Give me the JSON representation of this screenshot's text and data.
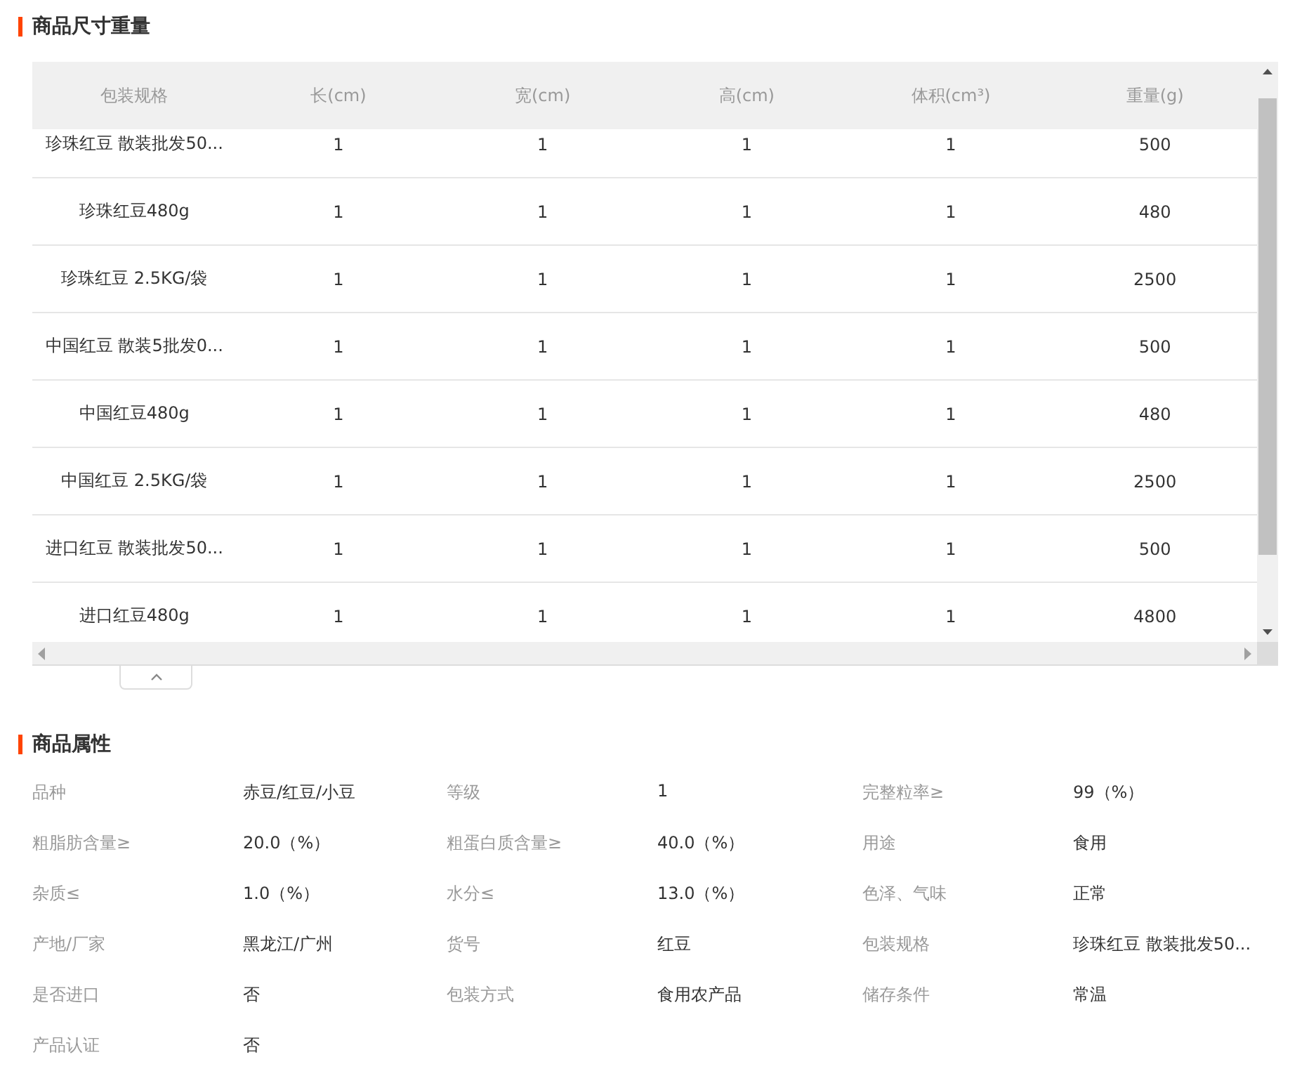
{
  "size_section": {
    "title": "商品尺寸重量",
    "table": {
      "columns": [
        "包装规格",
        "长(cm)",
        "宽(cm)",
        "高(cm)",
        "体积(cm³)",
        "重量(g)"
      ],
      "rows": [
        [
          "珍珠红豆 散装批发50...",
          "1",
          "1",
          "1",
          "1",
          "500"
        ],
        [
          "珍珠红豆480g",
          "1",
          "1",
          "1",
          "1",
          "480"
        ],
        [
          "珍珠红豆 2.5KG/袋",
          "1",
          "1",
          "1",
          "1",
          "2500"
        ],
        [
          "中国红豆 散装5批发0...",
          "1",
          "1",
          "1",
          "1",
          "500"
        ],
        [
          "中国红豆480g",
          "1",
          "1",
          "1",
          "1",
          "480"
        ],
        [
          "中国红豆 2.5KG/袋",
          "1",
          "1",
          "1",
          "1",
          "2500"
        ],
        [
          "进口红豆 散装批发50...",
          "1",
          "1",
          "1",
          "1",
          "500"
        ],
        [
          "进口红豆480g",
          "1",
          "1",
          "1",
          "1",
          "4800"
        ]
      ]
    }
  },
  "attributes_section": {
    "title": "商品属性",
    "attributes": [
      {
        "label": "品种",
        "value": "赤豆/红豆/小豆"
      },
      {
        "label": "等级",
        "value": "1"
      },
      {
        "label": "完整粒率≥",
        "value": "99（%）"
      },
      {
        "label": "粗脂肪含量≥",
        "value": "20.0（%）"
      },
      {
        "label": "粗蛋白质含量≥",
        "value": "40.0（%）"
      },
      {
        "label": "用途",
        "value": "食用"
      },
      {
        "label": "杂质≤",
        "value": "1.0（%）"
      },
      {
        "label": "水分≤",
        "value": "13.0（%）"
      },
      {
        "label": "色泽、气味",
        "value": "正常"
      },
      {
        "label": "产地/厂家",
        "value": "黑龙江/广州"
      },
      {
        "label": "货号",
        "value": "红豆"
      },
      {
        "label": "包装规格",
        "value": "珍珠红豆 散装批发50..."
      },
      {
        "label": "是否进口",
        "value": "否"
      },
      {
        "label": "包装方式",
        "value": "食用农产品"
      },
      {
        "label": "储存条件",
        "value": "常温"
      },
      {
        "label": "产品认证",
        "value": "否"
      }
    ]
  }
}
